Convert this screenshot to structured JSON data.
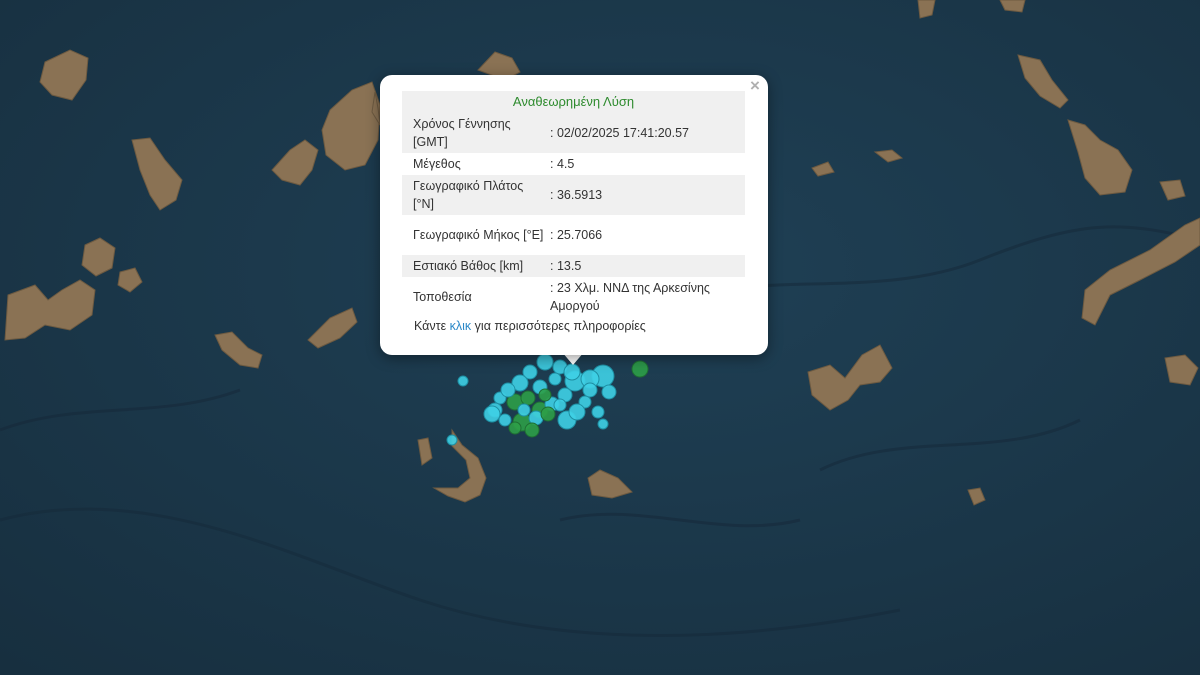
{
  "map": {
    "colors": {
      "sea": "#1d3a4c",
      "land": "#8a7254",
      "marker_cyan": "#3fd0e6",
      "marker_green": "#2e9e48"
    }
  },
  "popup": {
    "title": "Αναθεωρημένη Λύση",
    "close_label": "×",
    "rows": [
      {
        "label": "Χρόνος Γέννησης [GMT]",
        "value": ": 02/02/2025 17:41:20.57"
      },
      {
        "label": "Μέγεθος",
        "value": ": 4.5"
      },
      {
        "label": "Γεωγραφικό Πλάτος [°N]",
        "value": ": 36.5913"
      },
      {
        "label": "Γεωγραφικό Μήκος [°E]",
        "value": ": 25.7066"
      },
      {
        "label": "Εστιακό Βάθος [km]",
        "value": ": 13.5"
      },
      {
        "label": "Τοποθεσία",
        "value": ": 23 Χλμ. ΝΝΔ της Αρκεσίνης Αμοργού"
      }
    ],
    "more_prefix": "Κάντε",
    "more_link": "κλικ",
    "more_suffix": "για περισσότερες πληροφορίες"
  }
}
